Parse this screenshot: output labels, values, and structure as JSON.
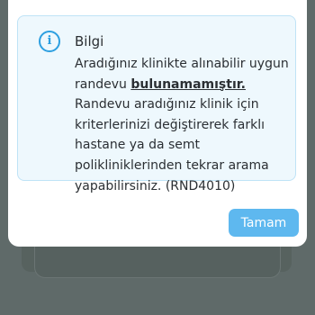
{
  "dialog": {
    "title": "Bilgi",
    "message_part1": "Aradığınız klinikte alınabilir uygun randevu ",
    "message_bold": "bulunamamıştır.",
    "message_part2": " Randevu aradığınız klinik için kriterlerinizi değiştirerek farklı hastane ya da semt polikliniklerinden tekrar arama yapabilirsiniz. (RND4010)",
    "ok_label": "Tamam",
    "icon": "info-icon",
    "icon_glyph": "i"
  },
  "colors": {
    "accent": "#2d9fe0",
    "button": "#5eb8ef",
    "info_background": "#eef8fd",
    "info_border": "#bfe3f6",
    "backdrop": "#5f6a69"
  }
}
